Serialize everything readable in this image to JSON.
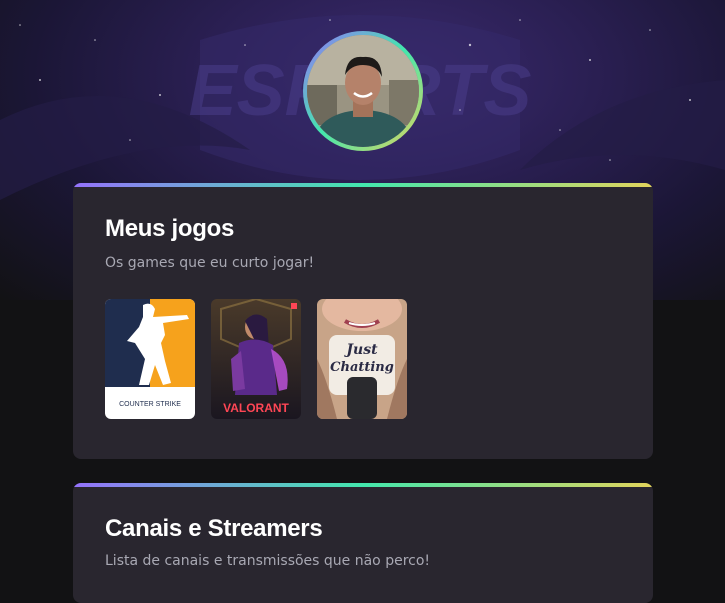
{
  "profile": {
    "avatar_alt": "avatar",
    "background_logo": "ESPORTS"
  },
  "games_section": {
    "title": "Meus jogos",
    "subtitle": "Os games que eu curto jogar!",
    "games": [
      {
        "name": "Counter-Strike",
        "logo_text": "COUNTER STRIKE"
      },
      {
        "name": "Valorant",
        "logo_text": "VALORANT"
      },
      {
        "name": "Just Chatting",
        "logo_text_1": "Just",
        "logo_text_2": "Chatting"
      }
    ]
  },
  "channels_section": {
    "title": "Canais e Streamers",
    "subtitle": "Lista de canais e transmissões que não perco!"
  },
  "colors": {
    "background": "#121214",
    "card": "#29262f",
    "gradient": [
      "#9572fc",
      "#43e7ad",
      "#e2d45c"
    ],
    "subtitle": "#a8a8b3"
  }
}
